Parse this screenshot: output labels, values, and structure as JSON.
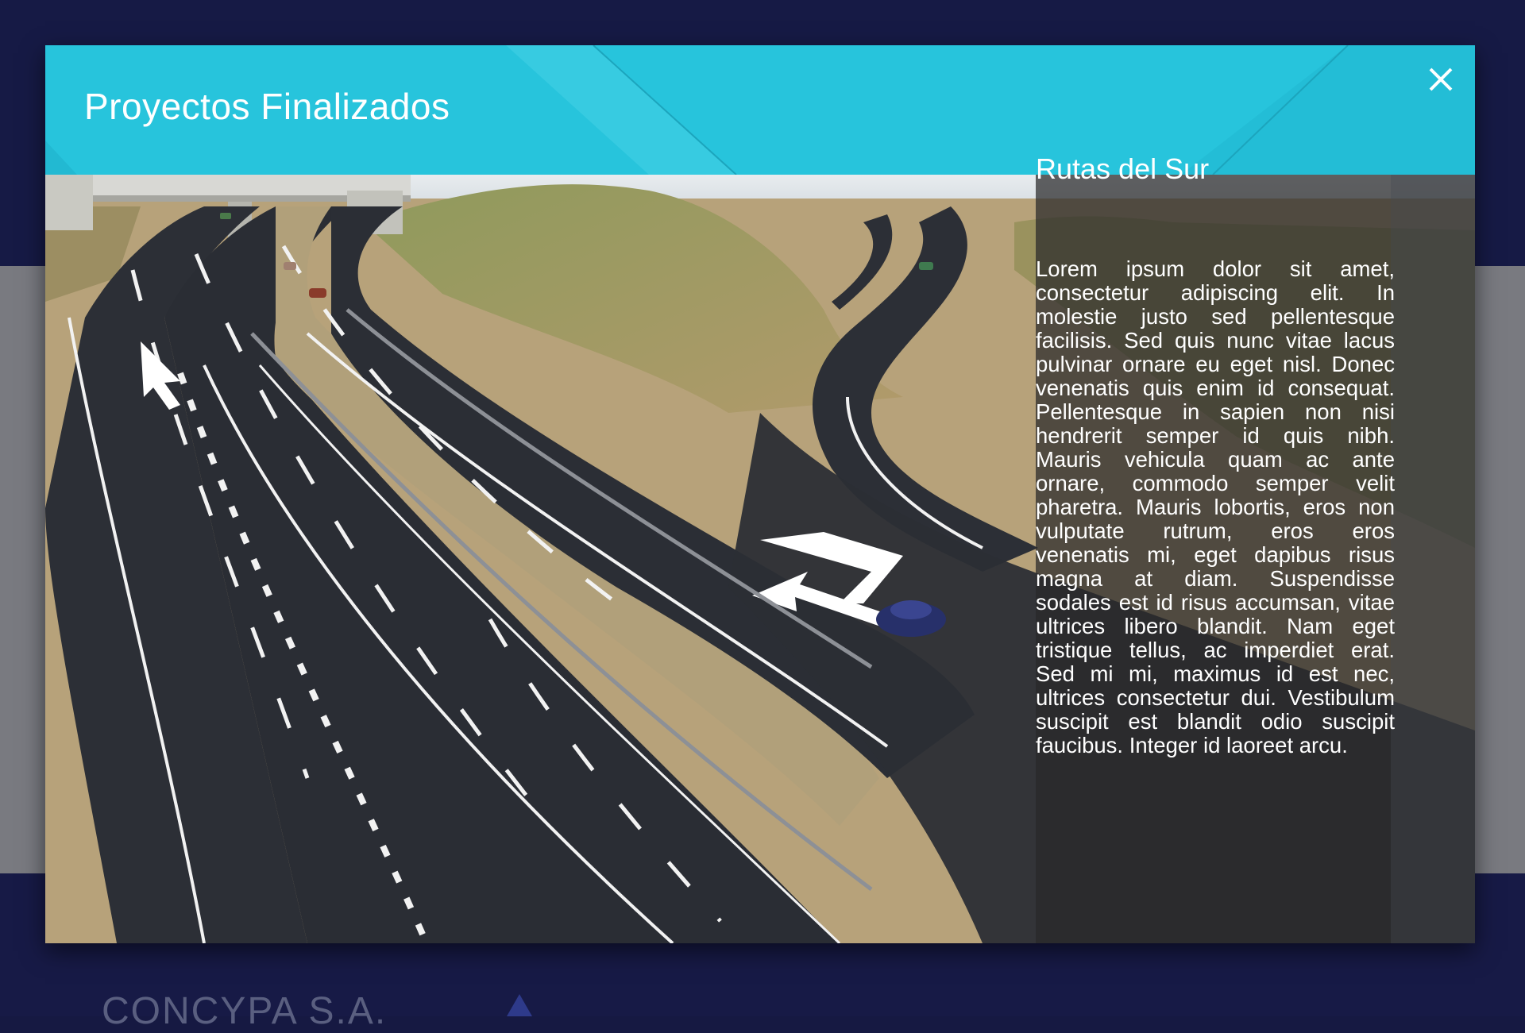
{
  "background": {
    "company_name": "CONCYPA S.A."
  },
  "modal": {
    "title": "Proyectos Finalizados",
    "close_icon": "close-icon",
    "image_subject": "highway",
    "project": {
      "name": "Rutas del Sur",
      "description": "Lorem ipsum dolor sit amet, consectetur adipiscing elit. In molestie justo sed pellentesque facilisis. Sed quis nunc vitae lacus pulvinar ornare eu eget nisl. Donec venenatis quis enim id consequat. Pellentesque in sapien non nisi hendrerit semper id quis nibh. Mauris vehicula quam ac ante ornare, commodo semper velit pharetra. Mauris lobortis, eros non vulputate rutrum, eros eros venenatis mi, eget dapibus risus magna at diam. Suspendisse sodales est id risus accumsan, vitae ultrices libero blandit. Nam eget tristique tellus, ac imperdiet erat. Sed mi mi, maximus id est nec, ultrices consectetur dui. Vestibulum suscipit est blandit odio suscipit faucibus. Integer id laoreet arcu."
    }
  },
  "colors": {
    "header": "#27c4dc",
    "page_background": "#161942",
    "panel_overlay": "#28282a"
  }
}
